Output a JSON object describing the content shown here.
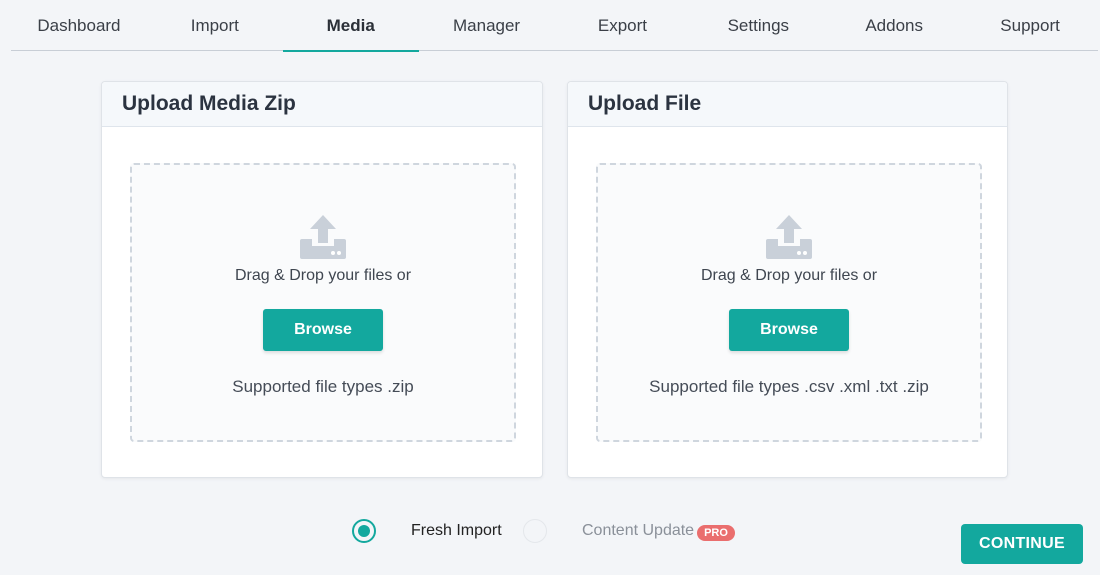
{
  "tabs": [
    {
      "label": "Dashboard",
      "active": false
    },
    {
      "label": "Import",
      "active": false
    },
    {
      "label": "Media",
      "active": true
    },
    {
      "label": "Manager",
      "active": false
    },
    {
      "label": "Export",
      "active": false
    },
    {
      "label": "Settings",
      "active": false
    },
    {
      "label": "Addons",
      "active": false
    },
    {
      "label": "Support",
      "active": false
    }
  ],
  "media_card": {
    "title": "Upload Media Zip",
    "drag_text": "Drag & Drop your files or",
    "browse_label": "Browse",
    "supported_text": "Supported file types .zip",
    "icon": "upload-icon"
  },
  "file_card": {
    "title": "Upload File",
    "drag_text": "Drag & Drop your files or",
    "browse_label": "Browse",
    "supported_text": "Supported file types .csv .xml .txt .zip",
    "icon": "upload-icon"
  },
  "import_mode": {
    "options": [
      {
        "label": "Fresh Import",
        "checked": true,
        "disabled": false
      },
      {
        "label": "Content Update",
        "checked": false,
        "disabled": true,
        "badge": "PRO"
      }
    ]
  },
  "continue_label": "CONTINUE",
  "colors": {
    "accent": "#13a89e",
    "pro_badge": "#ea6e6e",
    "background": "#f3f5f8"
  }
}
